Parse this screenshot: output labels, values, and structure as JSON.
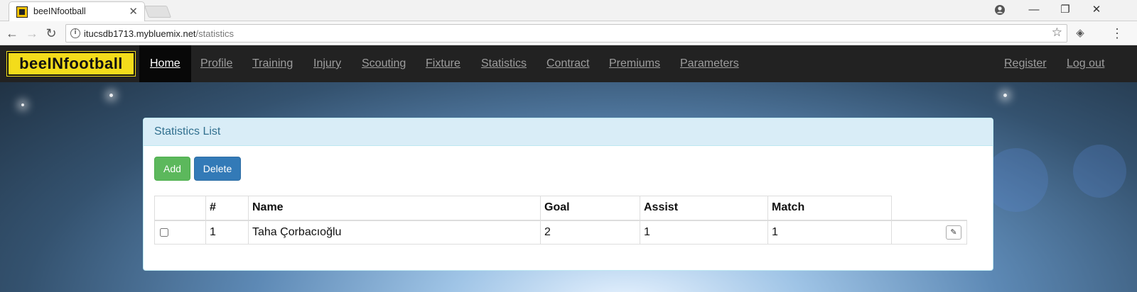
{
  "browser": {
    "tab_title": "beeINfootball",
    "url_host": "itucsdb1713.mybluemix.net",
    "url_path": "/statistics"
  },
  "navbar": {
    "brand": "beeINfootball",
    "items": [
      {
        "label": "Home",
        "active": true
      },
      {
        "label": "Profile"
      },
      {
        "label": "Training"
      },
      {
        "label": "Injury"
      },
      {
        "label": "Scouting"
      },
      {
        "label": "Fixture"
      },
      {
        "label": "Statistics"
      },
      {
        "label": "Contract"
      },
      {
        "label": "Premiums"
      },
      {
        "label": "Parameters"
      }
    ],
    "right_items": [
      {
        "label": "Register"
      },
      {
        "label": "Log out"
      }
    ]
  },
  "panel": {
    "title": "Statistics List",
    "add_label": "Add",
    "delete_label": "Delete"
  },
  "table": {
    "columns": [
      "",
      "#",
      "Name",
      "Goal",
      "Assist",
      "Match"
    ],
    "rows": [
      {
        "id": "1",
        "name": "Taha Çorbacıoğlu",
        "goal": "2",
        "assist": "1",
        "match": "1"
      }
    ]
  }
}
